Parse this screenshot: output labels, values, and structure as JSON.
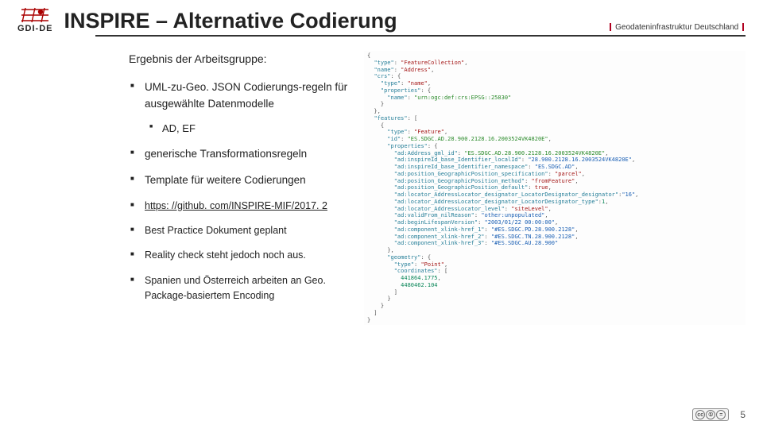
{
  "header": {
    "logo_text": "GDI-DE",
    "title": "INSPIRE – Alternative Codierung",
    "subtitle": "Geodateninfrastruktur Deutschland"
  },
  "left": {
    "intro": "Ergebnis der Arbeitsgruppe:",
    "items_top": [
      "UML-zu-Geo. JSON Codierungs-regeln für ausgewählte Datenmodelle"
    ],
    "sub_items": [
      "AD, EF"
    ],
    "items_mid": [
      "generische Transformationsregeln",
      "Template für weitere Codierungen"
    ],
    "link_text": "https: //github. com/INSPIRE-MIF/2017. 2",
    "items_small": [
      "Best Practice Dokument geplant",
      "Reality check steht jedoch noch aus.",
      "Spanien und Österreich arbeiten an Geo. Package-basiertem Encoding"
    ]
  },
  "code_lines": [
    "{",
    "  <k>\"type\"</k>: <s>\"FeatureCollection\"</s>,",
    "  <k>\"name\"</k>: <s>\"Address\"</s>,",
    "  <k>\"crs\"</k>: {",
    "    <k>\"type\"</k>: <s>\"name\"</s>,",
    "    <k>\"properties\"</k>: {",
    "      <k>\"name\"</k>: <sg>\"urn:ogc:def:crs:EPSG::25830\"</sg>",
    "    }",
    "  },",
    "  <k>\"features\"</k>: [",
    "    {",
    "      <k>\"type\"</k>: <s>\"Feature\"</s>,",
    "      <k>\"id\"</k>: <sg>\"ES.SDGC.AD.28.900.2128.16.2003524VK4820E\"</sg>,",
    "      <k>\"properties\"</k>: {",
    "        <k>\"ad:Address_gml_id\"</k>: <sg>\"ES.SDGC.AD.28.900.2128.16.2003524VK4820E\"</sg>,",
    "        <k>\"ad:inspireId_base_Identifier_localId\"</k>: <sb>\"28.900.2128.16.2003524VK4820E\"</sb>,",
    "        <k>\"ad:inspireId_base_Identifier_namespace\"</k>: <sb>\"ES.SDGC.AD\"</sb>,",
    "        <k>\"ad:position_GeographicPosition_specification\"</k>: <s>\"parcel\"</s>,",
    "        <k>\"ad:position_GeographicPosition_method\"</k>: <s>\"fromFeature\"</s>,",
    "        <k>\"ad:position_GeographicPosition_default\"</k>: <s>true</s>,",
    "        <k>\"ad:locator_AddressLocator_designator_LocatorDesignator_designator\"</k>:<sb>\"16\"</sb>,",
    "        <k>\"ad:locator_AddressLocator_designator_LocatorDesignator_type\"</k>:<n>1</n>,",
    "        <k>\"ad:locator_AddressLocator_level\"</k>: <s>\"siteLevel\"</s>,",
    "        <k>\"ad:validFrom_nilReason\"</k>: <sb>\"other:unpopulated\"</sb>,",
    "        <k>\"ad:beginLifespanVersion\"</k>: <sb>\"2003/01/22 00:00:00\"</sb>,",
    "        <k>\"ad:component_xlink-href_1\"</k>: <sb>\"#ES.SDGC.PD.28.900.2128\"</sb>,",
    "        <k>\"ad:component_xlink-href_2\"</k>: <sb>\"#ES.SDGC.TN.28.900.2128\"</sb>,",
    "        <k>\"ad:component_xlink-href_3\"</k>: <sb>\"#ES.SDGC.AU.28.900\"</sb>",
    "      },",
    "      <k>\"geometry\"</k>: {",
    "        <k>\"type\"</k>: <s>\"Point\"</s>,",
    "        <k>\"coordinates\"</k>: [",
    "          <n>441864.1775</n>,",
    "          <n>4480462.104</n>",
    "        ]",
    "      }",
    "    }",
    "  ]",
    "}"
  ],
  "footer": {
    "cc_parts": [
      "cc",
      "①",
      "="
    ],
    "page_number": "5"
  }
}
